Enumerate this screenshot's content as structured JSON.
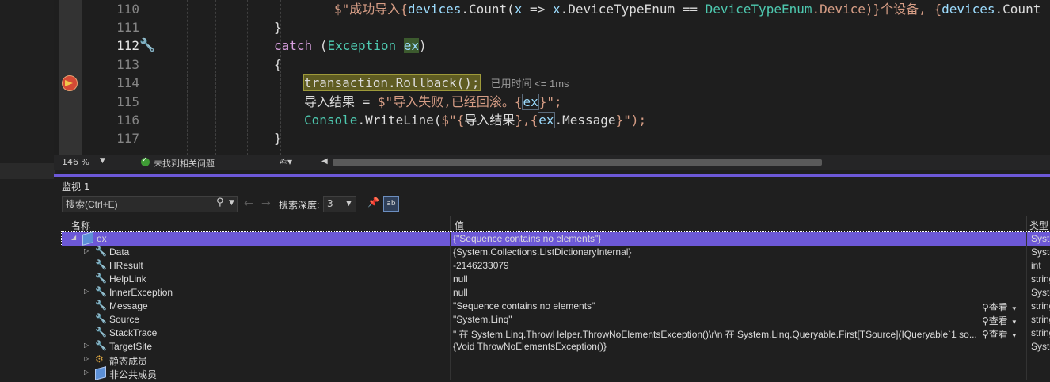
{
  "editor": {
    "lines": [
      {
        "num": "110",
        "tokens": [
          {
            "t": "$\"成功导入{",
            "c": "str"
          },
          {
            "t": "devices",
            "c": "var"
          },
          {
            "t": ".Count(",
            "c": "plain"
          },
          {
            "t": "x",
            "c": "var"
          },
          {
            "t": " => ",
            "c": "plain"
          },
          {
            "t": "x",
            "c": "var"
          },
          {
            "t": ".DeviceTypeEnum == ",
            "c": "plain"
          },
          {
            "t": "DeviceTypeEnum",
            "c": "ty"
          },
          {
            "t": ".Device)}个设备, {",
            "c": "str"
          },
          {
            "t": "devices",
            "c": "var"
          },
          {
            "t": ".Count",
            "c": "plain"
          }
        ]
      },
      {
        "num": "111",
        "tokens": [
          {
            "t": "}",
            "c": "plain"
          }
        ]
      },
      {
        "num": "112",
        "tokens": [
          {
            "t": "catch",
            "c": "kw"
          },
          {
            "t": " (",
            "c": "plain"
          },
          {
            "t": "Exception",
            "c": "ty"
          },
          {
            "t": " ",
            "c": "plain"
          },
          {
            "t": "ex",
            "c": "var hl-ex"
          },
          {
            "t": ")",
            "c": "plain"
          }
        ]
      },
      {
        "num": "113",
        "tokens": [
          {
            "t": "{",
            "c": "plain"
          }
        ]
      },
      {
        "num": "114",
        "tokens": [
          {
            "t": "transaction.Rollback();",
            "c": "stmt-hl"
          }
        ],
        "elapsed": "已用时间 <= 1ms"
      },
      {
        "num": "115",
        "tokens": [
          {
            "t": "导入结果",
            "c": "plain"
          },
          {
            "t": " = ",
            "c": "plain"
          },
          {
            "t": "$\"导入失败,已经回滚。{",
            "c": "str"
          },
          {
            "t": "ex",
            "c": "var hl-brace"
          },
          {
            "t": "}\";",
            "c": "str"
          }
        ]
      },
      {
        "num": "116",
        "tokens": [
          {
            "t": "Console",
            "c": "ty"
          },
          {
            "t": ".WriteLine(",
            "c": "plain"
          },
          {
            "t": "$\"{",
            "c": "str"
          },
          {
            "t": "导入结果",
            "c": "plain"
          },
          {
            "t": "},{",
            "c": "str"
          },
          {
            "t": "ex",
            "c": "var hl-brace"
          },
          {
            "t": ".Message",
            "c": "plain"
          },
          {
            "t": "}\");",
            "c": "str"
          }
        ]
      },
      {
        "num": "117",
        "tokens": [
          {
            "t": "}",
            "c": "plain"
          }
        ]
      }
    ],
    "current_line": "112"
  },
  "statusbar": {
    "zoom": "146 %",
    "issues": "未找到相关问题"
  },
  "watch": {
    "title": "监视 1",
    "search_placeholder": "搜索(Ctrl+E)",
    "depth_label": "搜索深度:",
    "depth_value": "3",
    "ab_label": "ab",
    "columns": {
      "name": "名称",
      "value": "值",
      "type": "类型"
    },
    "viewer_label": "查看",
    "rows": [
      {
        "name": "ex",
        "value": "{\"Sequence contains no elements\"}",
        "type": "System.InvalidOperationException",
        "indent": 0,
        "expander": "expanded",
        "icon": "cube",
        "selected": true
      },
      {
        "name": "Data",
        "value": "{System.Collections.ListDictionaryInternal}",
        "type": "System.Collections.IDictionary",
        "indent": 1,
        "expander": "collapsed",
        "icon": "wrench"
      },
      {
        "name": "HResult",
        "value": "-2146233079",
        "type": "int",
        "indent": 1,
        "expander": "none",
        "icon": "wrench"
      },
      {
        "name": "HelpLink",
        "value": "null",
        "type": "string",
        "indent": 1,
        "expander": "none",
        "icon": "wrench"
      },
      {
        "name": "InnerException",
        "value": "null",
        "type": "System.Exception",
        "indent": 1,
        "expander": "collapsed",
        "icon": "wrench"
      },
      {
        "name": "Message",
        "value": "\"Sequence contains no elements\"",
        "type": "string",
        "indent": 1,
        "expander": "none",
        "icon": "wrench",
        "viewer": true
      },
      {
        "name": "Source",
        "value": "\"System.Linq\"",
        "type": "string",
        "indent": 1,
        "expander": "none",
        "icon": "wrench",
        "viewer": true
      },
      {
        "name": "StackTrace",
        "value": "\"   在 System.Linq.ThrowHelper.ThrowNoElementsException()\\r\\n   在 System.Linq.Queryable.First[TSource](IQueryable`1 so...",
        "type": "string",
        "indent": 1,
        "expander": "none",
        "icon": "wrench",
        "viewer": true
      },
      {
        "name": "TargetSite",
        "value": "{Void ThrowNoElementsException()}",
        "type": "System.Reflection.MethodBase",
        "indent": 1,
        "expander": "collapsed",
        "icon": "wrench"
      },
      {
        "name": "静态成员",
        "value": "",
        "type": "",
        "indent": 1,
        "expander": "collapsed",
        "icon": "static"
      },
      {
        "name": "非公共成员",
        "value": "",
        "type": "",
        "indent": 1,
        "expander": "collapsed",
        "icon": "cube"
      }
    ]
  }
}
